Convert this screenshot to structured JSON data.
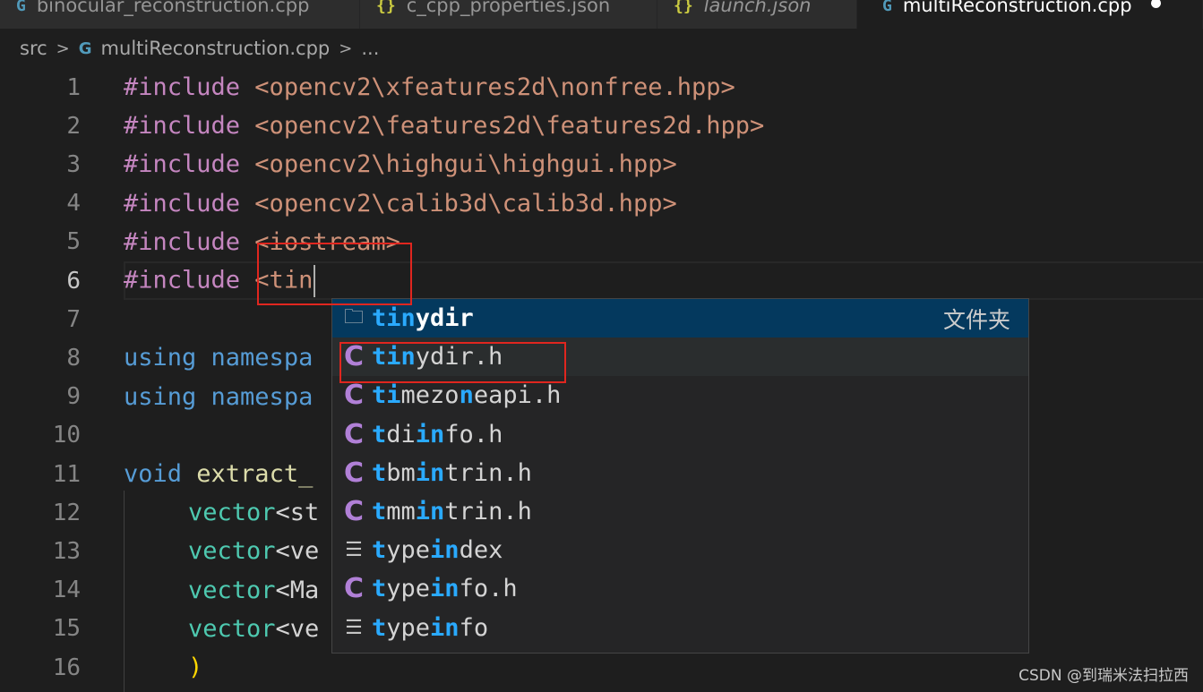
{
  "tabs": [
    {
      "label": "binocular_reconstruction.cpp",
      "icon": "cpp-file-icon",
      "active": false
    },
    {
      "label": "c_cpp_properties.json",
      "icon": "json-file-icon",
      "active": false
    },
    {
      "label": "launch.json",
      "icon": "json-file-icon",
      "active": false
    },
    {
      "label": "multiReconstruction.cpp",
      "icon": "cpp-file-icon",
      "active": true
    }
  ],
  "breadcrumb": {
    "folder": "src",
    "file": "multiReconstruction.cpp",
    "more": "..."
  },
  "lines": [
    {
      "n": "1",
      "pre": "#include",
      "rest": " <opencv2\\xfeatures2d\\nonfree.hpp>"
    },
    {
      "n": "2",
      "pre": "#include",
      "rest": " <opencv2\\features2d\\features2d.hpp>"
    },
    {
      "n": "3",
      "pre": "#include",
      "rest": " <opencv2\\highgui\\highgui.hpp>"
    },
    {
      "n": "4",
      "pre": "#include",
      "rest": " <opencv2\\calib3d\\calib3d.hpp>"
    },
    {
      "n": "5",
      "pre": "#include",
      "rest": " <iostream>"
    },
    {
      "n": "6",
      "pre": "#include",
      "rest": " <tin"
    },
    {
      "n": "7"
    },
    {
      "n": "8",
      "kw": "using",
      "rest": " namespa"
    },
    {
      "n": "9",
      "kw": "using",
      "rest": " namespa"
    },
    {
      "n": "10"
    },
    {
      "n": "11",
      "kw": "void",
      "fn": " extract_"
    },
    {
      "n": "12",
      "type": "vector",
      "rest": "<st"
    },
    {
      "n": "13",
      "type": "vector",
      "rest": "<ve"
    },
    {
      "n": "14",
      "type": "vector",
      "rest": "<Ma"
    },
    {
      "n": "15",
      "type": "vector",
      "rest": "<ve"
    },
    {
      "n": "16",
      "paren": ")"
    }
  ],
  "suggestions": [
    {
      "match": "tin",
      "rest": "ydir",
      "icon": "folder-icon",
      "detail": "文件夹"
    },
    {
      "match": "tin",
      "rest": "ydir.h",
      "icon": "c-file-icon"
    },
    {
      "parts": [
        [
          "t",
          "hl"
        ],
        [
          "i",
          "hl"
        ],
        [
          "mezo",
          ""
        ],
        [
          "n",
          "hl"
        ],
        [
          "eapi.h",
          ""
        ]
      ],
      "icon": "c-file-icon"
    },
    {
      "parts": [
        [
          "t",
          "hl"
        ],
        [
          "di",
          ""
        ],
        [
          "in",
          "hl"
        ],
        [
          "fo.h",
          ""
        ]
      ],
      "icon": "c-file-icon"
    },
    {
      "parts": [
        [
          "t",
          "hl"
        ],
        [
          "bm",
          ""
        ],
        [
          "in",
          "hl"
        ],
        [
          "trin.h",
          ""
        ]
      ],
      "icon": "c-file-icon"
    },
    {
      "parts": [
        [
          "t",
          "hl"
        ],
        [
          "mm",
          ""
        ],
        [
          "in",
          "hl"
        ],
        [
          "trin.h",
          ""
        ]
      ],
      "icon": "c-file-icon"
    },
    {
      "parts": [
        [
          "t",
          "hl"
        ],
        [
          "ype",
          ""
        ],
        [
          "in",
          "hl"
        ],
        [
          "dex",
          ""
        ]
      ],
      "icon": "lines-icon"
    },
    {
      "parts": [
        [
          "t",
          "hl"
        ],
        [
          "ype",
          ""
        ],
        [
          "in",
          "hl"
        ],
        [
          "fo.h",
          ""
        ]
      ],
      "icon": "c-file-icon"
    },
    {
      "parts": [
        [
          "t",
          "hl"
        ],
        [
          "ype",
          ""
        ],
        [
          "in",
          "hl"
        ],
        [
          "fo",
          ""
        ]
      ],
      "icon": "lines-icon"
    }
  ],
  "watermark": "CSDN @到瑞米法扫拉西",
  "colors": {
    "accent": "#04395e",
    "highlight": "#2aaaff",
    "annotation": "#e0261f"
  }
}
